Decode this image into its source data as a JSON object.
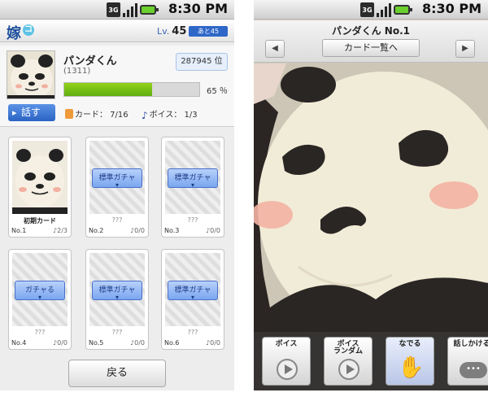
{
  "status": {
    "network": "3G",
    "time": "8:30 PM"
  },
  "left": {
    "logo": "嫁",
    "logo_mark": "コ",
    "level_label": "Lv.",
    "level_value": "45",
    "remaining": "あと45",
    "profile": {
      "name": "パンダくん",
      "id": "(1311)",
      "rank": "287945 位",
      "gauge_percent": 65,
      "gauge_label": "65 ％",
      "talk_button": "話す",
      "cards_stat": "カード： 7/16",
      "voice_stat": "ボイス： 1/3"
    },
    "cards": [
      {
        "title": "初期カード",
        "no": "No.1",
        "voice": "♪2/3",
        "button": ""
      },
      {
        "title": "???",
        "no": "No.2",
        "voice": "♪0/0",
        "button": "標準ガチャ"
      },
      {
        "title": "???",
        "no": "No.3",
        "voice": "♪0/0",
        "button": "標準ガチャ"
      },
      {
        "title": "???",
        "no": "No.4",
        "voice": "♪0/0",
        "button": "ガチャる"
      },
      {
        "title": "???",
        "no": "No.5",
        "voice": "♪0/0",
        "button": "標準ガチャ"
      },
      {
        "title": "???",
        "no": "No.6",
        "voice": "♪0/0",
        "button": "標準ガチャ"
      }
    ],
    "back_button": "戻る"
  },
  "right": {
    "title": "パンダくん No.1",
    "prev_icon": "◀",
    "next_icon": "▶",
    "list_button": "カード一覧へ",
    "actions": [
      {
        "label": "ボイス",
        "icon": "play-icon"
      },
      {
        "label": "ボイス\nランダム",
        "icon": "play-icon"
      },
      {
        "label": "なでる",
        "icon": "hand-icon"
      },
      {
        "label": "話しかける",
        "icon": "speech-bubble-icon"
      }
    ]
  }
}
